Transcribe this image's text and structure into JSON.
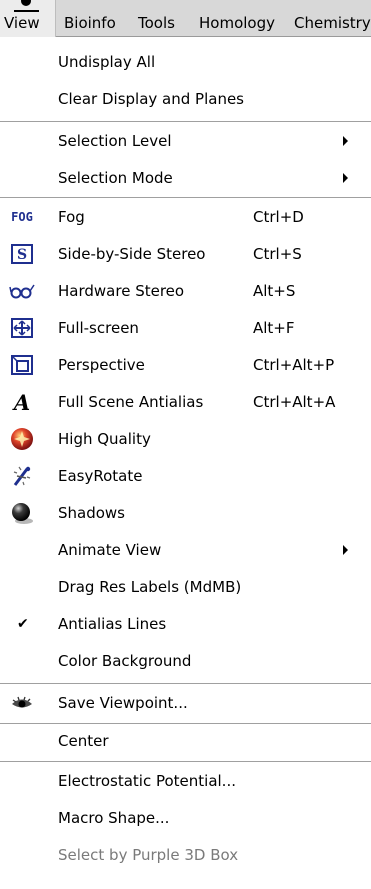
{
  "menubar": {
    "items": [
      "View",
      "Bioinfo",
      "Tools",
      "Homology",
      "Chemistry"
    ]
  },
  "menu": {
    "undisplay_all": "Undisplay All",
    "clear_display": "Clear Display and Planes",
    "selection_level": "Selection Level",
    "selection_mode": "Selection Mode",
    "fog": {
      "label": "Fog",
      "shortcut": "Ctrl+D",
      "icon": "fog-icon"
    },
    "side_by_side": {
      "label": "Side-by-Side Stereo",
      "shortcut": "Ctrl+S",
      "icon": "stereo-s-icon"
    },
    "hardware_stereo": {
      "label": "Hardware Stereo",
      "shortcut": "Alt+S",
      "icon": "stereo-glasses-icon"
    },
    "full_screen": {
      "label": "Full-screen",
      "shortcut": "Alt+F",
      "icon": "fullscreen-icon"
    },
    "perspective": {
      "label": "Perspective",
      "shortcut": "Ctrl+Alt+P",
      "icon": "perspective-icon"
    },
    "full_scene_aa": {
      "label": "Full Scene Antialias",
      "shortcut": "Ctrl+Alt+A",
      "icon": "antialias-a-icon"
    },
    "high_quality": {
      "label": "High Quality",
      "icon": "high-quality-icon"
    },
    "easy_rotate": {
      "label": "EasyRotate",
      "icon": "easy-rotate-icon"
    },
    "shadows": {
      "label": "Shadows",
      "icon": "shadows-icon"
    },
    "animate_view": "Animate View",
    "drag_res_labels": "Drag Res Labels (MdMB)",
    "antialias_lines": {
      "label": "Antialias Lines",
      "checked": true
    },
    "color_background": "Color Background",
    "save_viewpoint": {
      "label": "Save Viewpoint...",
      "icon": "eye-icon"
    },
    "center": "Center",
    "electrostatic": "Electrostatic Potential...",
    "macro_shape": "Macro Shape...",
    "select_purple": "Select by Purple 3D Box",
    "fog_icon_text": "FOG",
    "checkmark": "✔"
  }
}
